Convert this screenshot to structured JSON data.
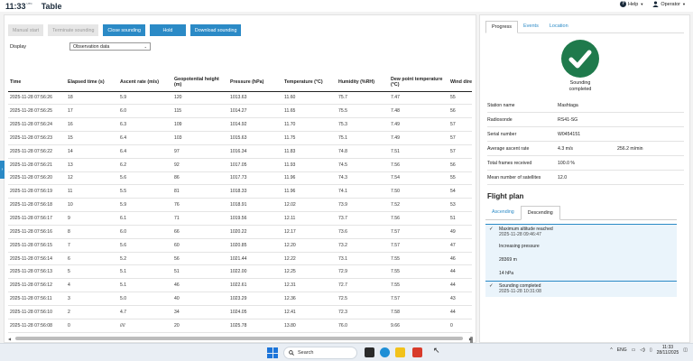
{
  "header": {
    "time": "11:33",
    "time_zone": "UTC",
    "title": "Table",
    "help_label": "Help",
    "operator_label": "Operator"
  },
  "toolbar": {
    "manual_start": "Manual start",
    "terminate_sounding": "Terminate sounding",
    "close_sounding": "Close sounding",
    "hold": "Hold",
    "download_sounding": "Download sounding"
  },
  "display": {
    "label": "Display",
    "selected": "Observation data"
  },
  "table": {
    "columns": [
      "Time",
      "Elapsed time (s)",
      "Ascent rate (m/s)",
      "Geopotential height (m)",
      "Pressure (hPa)",
      "Temperature (°C)",
      "Humidity (%RH)",
      "Dew point temperature (°C)",
      "Wind dire"
    ],
    "rows": [
      [
        "2025-11-28 07:56:26",
        "18",
        "5.9",
        "120",
        "1013.63",
        "11.60",
        "75.7",
        "7.47",
        "55"
      ],
      [
        "2025-11-28 07:56:25",
        "17",
        "6.0",
        "115",
        "1014.27",
        "11.65",
        "75.5",
        "7.48",
        "56"
      ],
      [
        "2025-11-28 07:56:24",
        "16",
        "6.3",
        "109",
        "1014.92",
        "11.70",
        "75.3",
        "7.49",
        "57"
      ],
      [
        "2025-11-28 07:56:23",
        "15",
        "6.4",
        "103",
        "1015.63",
        "11.75",
        "75.1",
        "7.49",
        "57"
      ],
      [
        "2025-11-28 07:56:22",
        "14",
        "6.4",
        "97",
        "1016.34",
        "11.83",
        "74.8",
        "7.51",
        "57"
      ],
      [
        "2025-11-28 07:56:21",
        "13",
        "6.2",
        "92",
        "1017.05",
        "11.93",
        "74.5",
        "7.56",
        "56"
      ],
      [
        "2025-11-28 07:56:20",
        "12",
        "5.6",
        "86",
        "1017.73",
        "11.96",
        "74.3",
        "7.54",
        "55"
      ],
      [
        "2025-11-28 07:56:19",
        "11",
        "5.5",
        "81",
        "1018.33",
        "11.96",
        "74.1",
        "7.50",
        "54"
      ],
      [
        "2025-11-28 07:56:18",
        "10",
        "5.9",
        "76",
        "1018.91",
        "12.02",
        "73.9",
        "7.52",
        "53"
      ],
      [
        "2025-11-28 07:56:17",
        "9",
        "6.1",
        "71",
        "1019.56",
        "12.11",
        "73.7",
        "7.56",
        "51"
      ],
      [
        "2025-11-28 07:56:16",
        "8",
        "6.0",
        "66",
        "1020.22",
        "12.17",
        "73.6",
        "7.57",
        "49"
      ],
      [
        "2025-11-28 07:56:15",
        "7",
        "5.6",
        "60",
        "1020.85",
        "12.20",
        "73.2",
        "7.57",
        "47"
      ],
      [
        "2025-11-28 07:56:14",
        "6",
        "5.2",
        "56",
        "1021.44",
        "12.22",
        "73.1",
        "7.55",
        "46"
      ],
      [
        "2025-11-28 07:56:13",
        "5",
        "5.1",
        "51",
        "1022.00",
        "12.25",
        "72.9",
        "7.55",
        "44"
      ],
      [
        "2025-11-28 07:56:12",
        "4",
        "5.1",
        "46",
        "1022.61",
        "12.31",
        "72.7",
        "7.55",
        "44"
      ],
      [
        "2025-11-28 07:56:11",
        "3",
        "5.0",
        "40",
        "1023.29",
        "12.36",
        "72.5",
        "7.57",
        "43"
      ],
      [
        "2025-11-28 07:56:10",
        "2",
        "4.7",
        "34",
        "1024.05",
        "12.41",
        "72.3",
        "7.58",
        "44"
      ],
      [
        "2025-11-28 07:56:08",
        "0",
        "////",
        "20",
        "1025.78",
        "13.80",
        "76.0",
        "9.66",
        "0"
      ]
    ]
  },
  "right_panel": {
    "tabs": [
      "Progress",
      "Events",
      "Location"
    ],
    "status_line1": "Sounding",
    "status_line2": "completed",
    "info": [
      {
        "key": "Station name",
        "value": "Mashtaga",
        "extra": ""
      },
      {
        "key": "Radiosonde",
        "value": "RS41-SG",
        "extra": ""
      },
      {
        "key": "Serial number",
        "value": "W0454151",
        "extra": ""
      },
      {
        "key": "Average ascent rate",
        "value": "4.3 m/s",
        "extra": "256.2 m/min"
      },
      {
        "key": "Total frames received",
        "value": "100.0 %",
        "extra": ""
      },
      {
        "key": "Mean number of satellites",
        "value": "12.0",
        "extra": ""
      }
    ],
    "flight_plan_title": "Flight plan",
    "flight_plan_tabs": [
      "Ascending",
      "Descending"
    ],
    "event1_title": "Maximum altitude reached",
    "event1_time": "2025-11-28 09:46:47",
    "event1_details": [
      "Increasing pressure",
      "28369 m",
      "14 hPa"
    ],
    "event2_title": "Sounding completed",
    "event2_time": "2025-11-28 10:31:08"
  },
  "taskbar": {
    "search_placeholder": "Search",
    "lang": "ENG",
    "clock_time": "11:33",
    "clock_date": "28/11/2025"
  },
  "colors": {
    "primary_button": "#2b8ac6",
    "success_green": "#1f7a4c",
    "event_highlight": "#eaf4fb"
  }
}
